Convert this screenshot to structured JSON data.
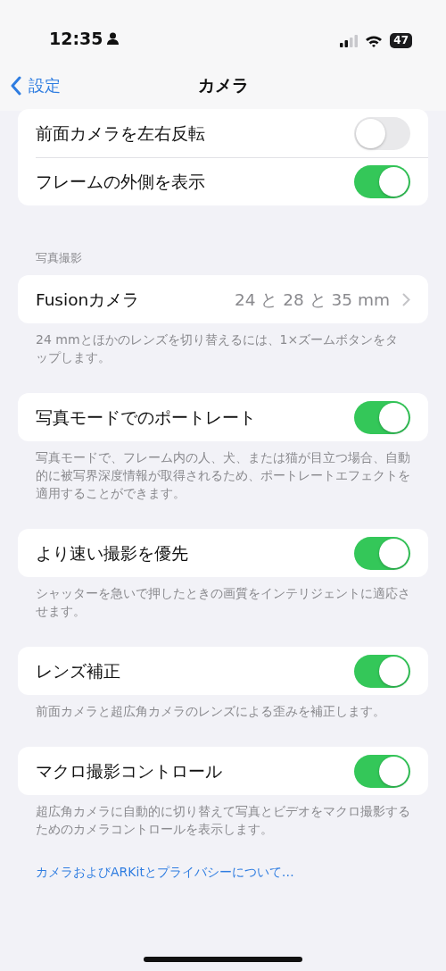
{
  "status_bar": {
    "time": "12:35",
    "battery": "47"
  },
  "nav": {
    "back": "設定",
    "title": "カメラ"
  },
  "sections": [
    {
      "rows": [
        {
          "kind": "toggle",
          "label": "前面カメラを左右反転",
          "on": false
        },
        {
          "kind": "toggle",
          "label": "フレームの外側を表示",
          "on": true
        }
      ]
    },
    {
      "header": "写真撮影",
      "rows": [
        {
          "kind": "link",
          "label": "Fusionカメラ",
          "value": "24 と 28 と 35 mm"
        }
      ],
      "footer": "24 mmとほかのレンズを切り替えるには、1×ズームボタンをタップします。"
    },
    {
      "rows": [
        {
          "kind": "toggle",
          "label": "写真モードでのポートレート",
          "on": true
        }
      ],
      "footer": "写真モードで、フレーム内の人、犬、または猫が目立つ場合、自動的に被写界深度情報が取得されるため、ポートレートエフェクトを適用することができます。"
    },
    {
      "rows": [
        {
          "kind": "toggle",
          "label": "より速い撮影を優先",
          "on": true
        }
      ],
      "footer": "シャッターを急いで押したときの画質をインテリジェントに適応させます。"
    },
    {
      "rows": [
        {
          "kind": "toggle",
          "label": "レンズ補正",
          "on": true
        }
      ],
      "footer": "前面カメラと超広角カメラのレンズによる歪みを補正します。"
    },
    {
      "rows": [
        {
          "kind": "toggle",
          "label": "マクロ撮影コントロール",
          "on": true
        }
      ],
      "footer": "超広角カメラに自動的に切り替えて写真とビデオをマクロ撮影するためのカメラコントロールを表示します。"
    }
  ],
  "privacy_link": "カメラおよびARKitとプライバシーについて…"
}
